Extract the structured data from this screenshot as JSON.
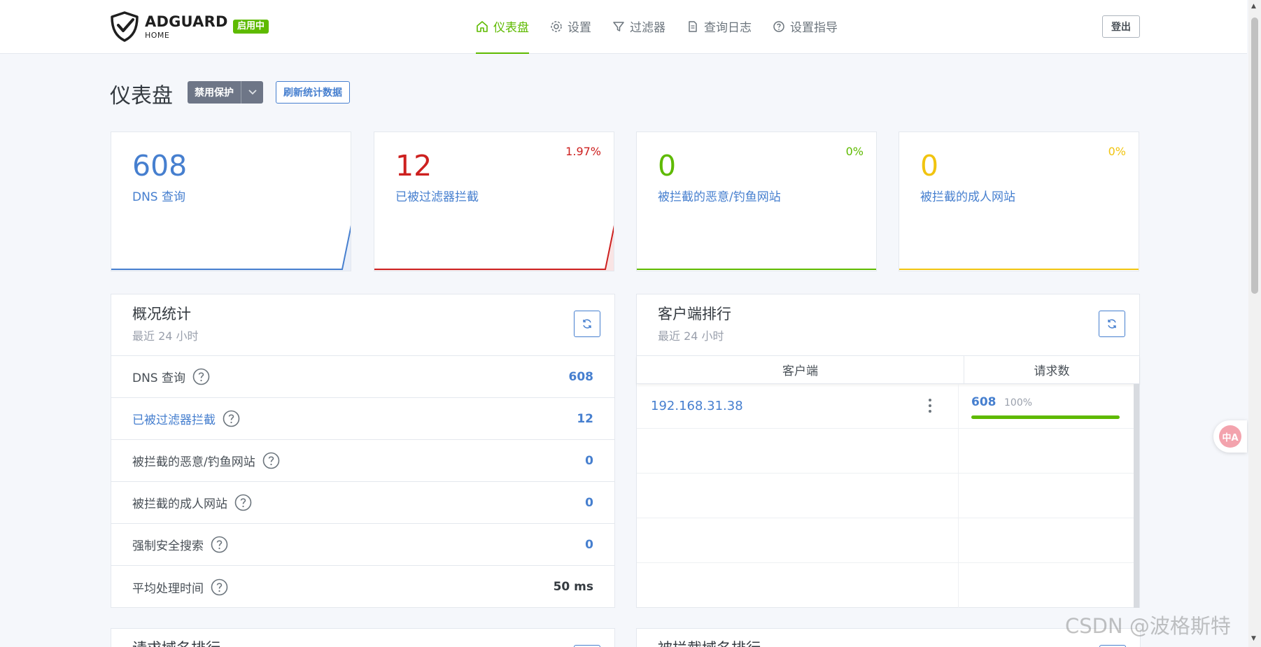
{
  "brand": {
    "title": "ADGUARD",
    "subtitle": "HOME",
    "status": "启用中"
  },
  "nav": [
    {
      "label": "仪表盘",
      "icon": "home-icon",
      "active": true
    },
    {
      "label": "设置",
      "icon": "gear-icon"
    },
    {
      "label": "过滤器",
      "icon": "filter-icon"
    },
    {
      "label": "查询日志",
      "icon": "document-icon"
    },
    {
      "label": "设置指导",
      "icon": "help-circle-icon"
    }
  ],
  "logout_label": "登出",
  "page": {
    "title": "仪表盘",
    "disable_protection": "禁用保护",
    "refresh_stats": "刷新统计数据"
  },
  "cards": [
    {
      "value": "608",
      "label": "DNS 查询",
      "percent": "",
      "color": "#467fcf"
    },
    {
      "value": "12",
      "label": "已被过滤器拦截",
      "percent": "1.97%",
      "color": "#cd201f"
    },
    {
      "value": "0",
      "label": "被拦截的恶意/钓鱼网站",
      "percent": "0%",
      "color": "#5eba00"
    },
    {
      "value": "0",
      "label": "被拦截的成人网站",
      "percent": "0%",
      "color": "#f1c40f"
    }
  ],
  "overview": {
    "title": "概况统计",
    "subtitle": "最近 24 小时",
    "rows": [
      {
        "label": "DNS 查询",
        "value": "608"
      },
      {
        "label": "已被过滤器拦截",
        "value": "12"
      },
      {
        "label": "被拦截的恶意/钓鱼网站",
        "value": "0"
      },
      {
        "label": "被拦截的成人网站",
        "value": "0"
      },
      {
        "label": "强制安全搜索",
        "value": "0"
      },
      {
        "label": "平均处理时间",
        "value": "50 ms"
      }
    ]
  },
  "clients": {
    "title": "客户端排行",
    "subtitle": "最近 24 小时",
    "col_client": "客户端",
    "col_requests": "请求数",
    "rows": [
      {
        "ip": "192.168.31.38",
        "count": "608",
        "percent": "100%",
        "fraction": 1.0
      }
    ]
  },
  "bottom": {
    "left_title": "请求域名排行",
    "right_title": "被拦截域名排行"
  },
  "watermark": "CSDN @波格斯特",
  "translate_icon_text": "中A"
}
